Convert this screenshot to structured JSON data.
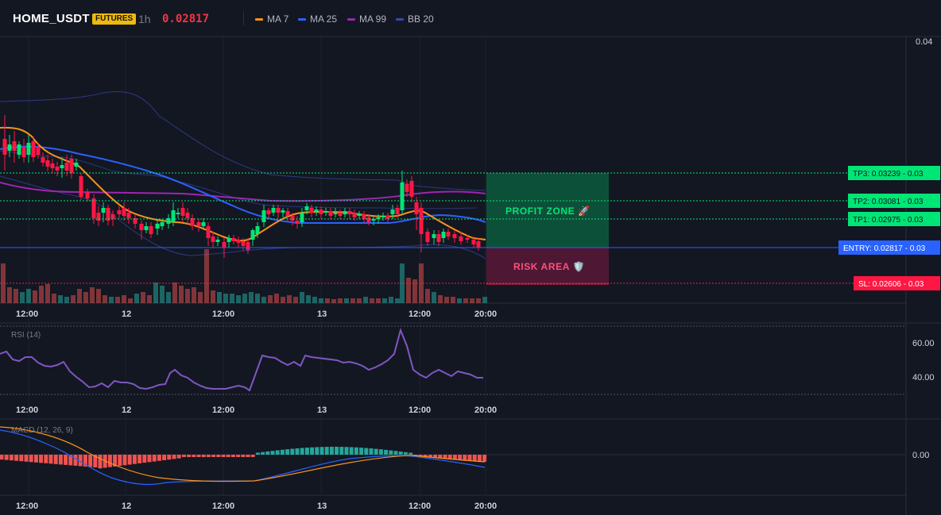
{
  "header": {
    "symbol": "HOME_USDT",
    "badge": "FUTURES",
    "timeframe": "1h",
    "last_price": "0.02817",
    "legend": [
      {
        "label": "MA 7",
        "color": "#f7931a"
      },
      {
        "label": "MA 25",
        "color": "#2962ff"
      },
      {
        "label": "MA 99",
        "color": "#9c27b0"
      },
      {
        "label": "BB 20",
        "color": "#3949ab"
      }
    ]
  },
  "price_axis": {
    "top_label": "0.04"
  },
  "time_axis": [
    "12:00",
    "12",
    "12:00",
    "13",
    "12:00",
    "20:00"
  ],
  "zones": {
    "profit": "PROFIT ZONE 🚀",
    "risk": "RISK AREA 🛡️"
  },
  "levels": [
    {
      "label": "TP3: 0.03239 - 0.03",
      "kind": "tp"
    },
    {
      "label": "TP2: 0.03081 - 0.03",
      "kind": "tp"
    },
    {
      "label": "TP1: 0.02975 - 0.03",
      "kind": "tp"
    },
    {
      "label": "ENTRY: 0.02817 - 0.03",
      "kind": "entry"
    },
    {
      "label": "SL: 0.02606 - 0.03",
      "kind": "sl"
    }
  ],
  "rsi": {
    "title": "RSI (14)",
    "ticks": [
      "60.00",
      "40.00"
    ]
  },
  "macd": {
    "title": "MACD (12, 26, 9)",
    "ticks": [
      "0.00"
    ]
  },
  "colors": {
    "background": "#131722",
    "up": "#00e676",
    "down": "#ff1744",
    "ma7": "#f7931a",
    "ma25": "#2962ff",
    "ma99": "#9c27b0",
    "bb": "#3949ab",
    "rsi": "#7e57c2",
    "tp": "#00e676",
    "entry": "#2962ff",
    "sl": "#ff1744"
  }
}
